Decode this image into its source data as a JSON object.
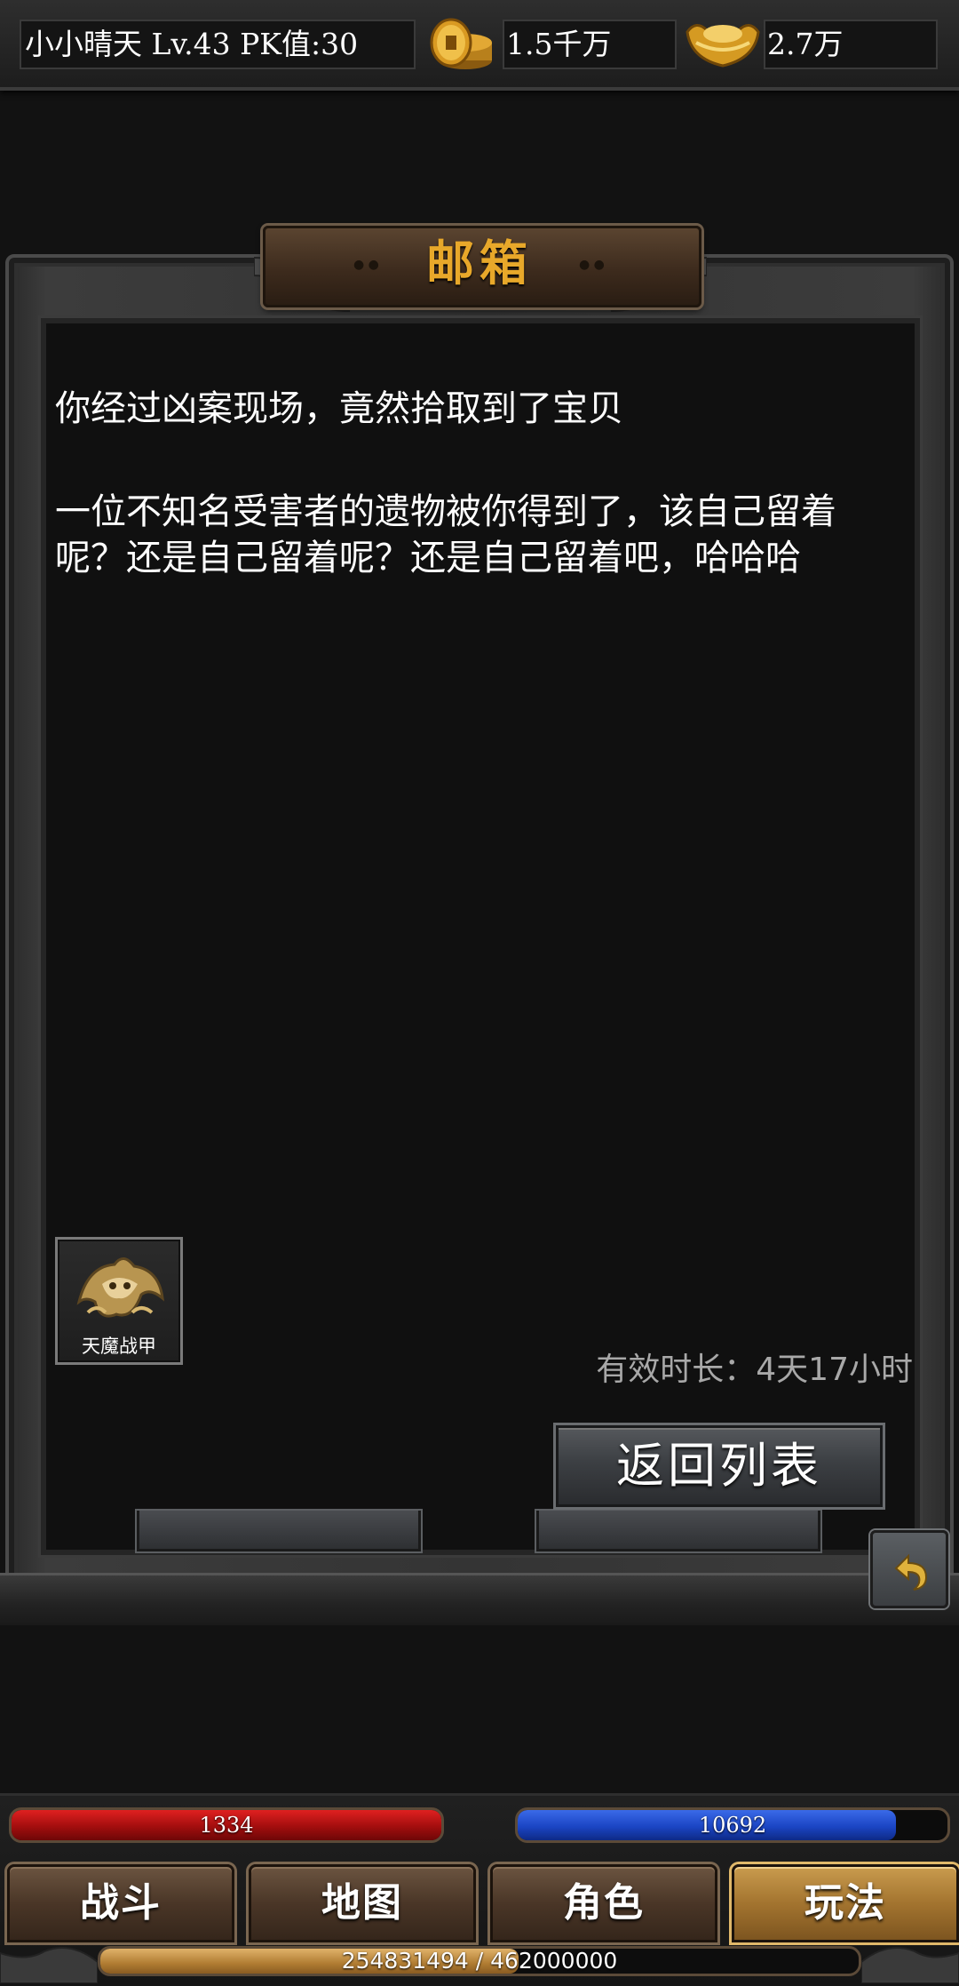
{
  "header": {
    "player_info": "小小晴天  Lv.43 PK值:30",
    "gold_amount": "1.5千万",
    "ingot_amount": "2.7万",
    "icons": [
      "gold-coins-icon",
      "gold-ingot-icon"
    ]
  },
  "mailbox": {
    "title": "邮箱",
    "subject": "你经过凶案现场，竟然拾取到了宝贝",
    "body": "一位不知名受害者的遗物被你得到了，该自己留着呢？还是自己留着呢？还是自己留着吧，哈哈哈",
    "attachment": {
      "name": "天魔战甲",
      "icon": "armor-icon"
    },
    "validity": "有效时长：4天17小时",
    "return_button": "返回列表"
  },
  "hud": {
    "hp_value": "1334",
    "hp_fraction": 1.0,
    "mp_value": "10692",
    "mp_fraction": 0.88,
    "nav": [
      {
        "label": "战斗",
        "active": false
      },
      {
        "label": "地图",
        "active": false
      },
      {
        "label": "角色",
        "active": false
      },
      {
        "label": "玩法",
        "active": true
      }
    ],
    "xp_text": "254831494 / 462000000",
    "xp_current": 254831494,
    "xp_max": 462000000
  },
  "colors": {
    "title_gold": "#e8a82a",
    "hp_red": "#c41212",
    "mp_blue": "#1b45c4",
    "panel_dark": "#101010"
  }
}
